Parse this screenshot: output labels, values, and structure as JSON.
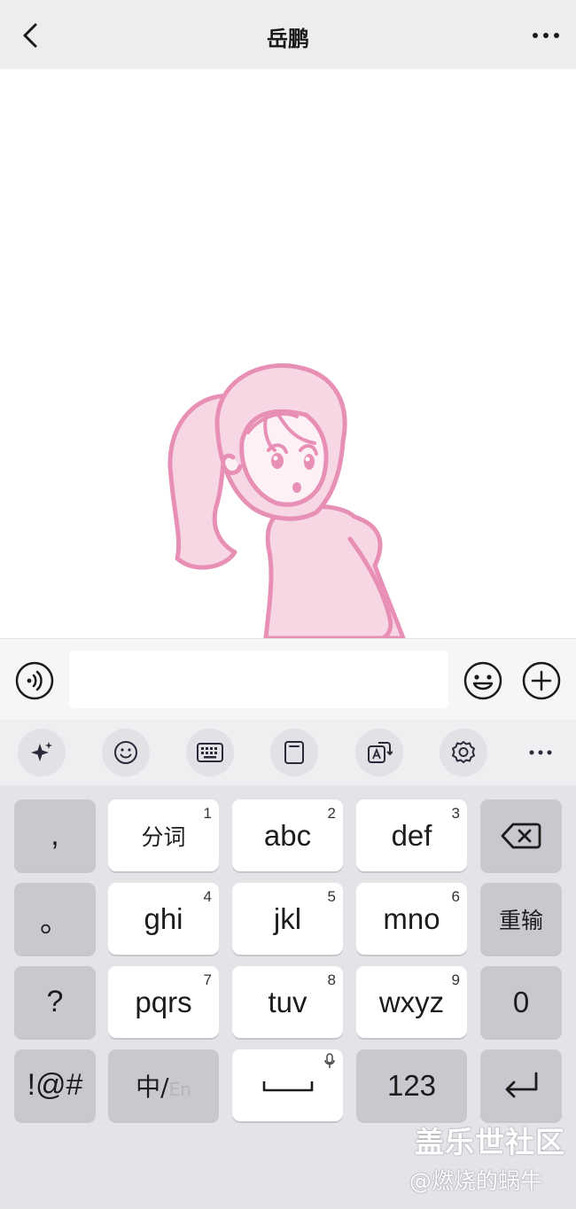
{
  "header": {
    "title": "岳鹏",
    "back_icon": "chevron-left-icon",
    "more_icon": "ellipsis-icon"
  },
  "input_bar": {
    "text_value": "",
    "voice_icon": "voice-icon",
    "emoji_icon": "smiley-icon",
    "plus_icon": "plus-circle-icon"
  },
  "toolbar": {
    "items": [
      "sparkle-icon",
      "emoji-icon",
      "keyboard-icon",
      "clipboard-icon",
      "translate-icon",
      "gear-icon",
      "more-icon"
    ]
  },
  "keyboard": {
    "left_column": [
      ",",
      "。",
      "?",
      "!@#"
    ],
    "rows": [
      [
        {
          "label": "分词",
          "num": "1"
        },
        {
          "label": "abc",
          "num": "2"
        },
        {
          "label": "def",
          "num": "3"
        }
      ],
      [
        {
          "label": "ghi",
          "num": "4"
        },
        {
          "label": "jkl",
          "num": "5"
        },
        {
          "label": "mno",
          "num": "6"
        }
      ],
      [
        {
          "label": "pqrs",
          "num": "7"
        },
        {
          "label": "tuv",
          "num": "8"
        },
        {
          "label": "wxyz",
          "num": "9"
        }
      ]
    ],
    "right_column": {
      "reinput": "重输",
      "zero": "0",
      "backspace_icon": "backspace-icon"
    },
    "bottom_row": {
      "lang_zh": "中/",
      "lang_en": "En",
      "num": "123",
      "mic_icon": "mic-icon",
      "enter_icon": "enter-icon"
    }
  },
  "watermark": {
    "line1": "盖乐世社区",
    "line2": "@燃烧的蜗牛"
  },
  "colors": {
    "header_bg": "#ededed",
    "sticker_pink": "#e88fb5",
    "keyboard_bg": "#e3e4e8"
  }
}
